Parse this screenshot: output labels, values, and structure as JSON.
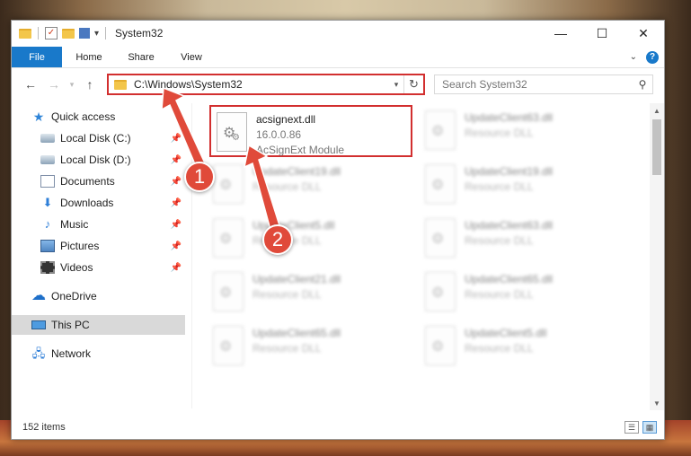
{
  "window": {
    "title": "System32",
    "controls": {
      "minimize": "—",
      "maximize": "☐",
      "close": "✕"
    }
  },
  "ribbon": {
    "tabs": [
      "File",
      "Home",
      "Share",
      "View"
    ],
    "help": "?"
  },
  "address": {
    "path": "C:\\Windows\\System32",
    "search_placeholder": "Search System32"
  },
  "navpane": {
    "quick_access": "Quick access",
    "items": [
      "Local Disk (C:)",
      "Local Disk (D:)",
      "Documents",
      "Downloads",
      "Music",
      "Pictures",
      "Videos"
    ],
    "onedrive": "OneDrive",
    "this_pc": "This PC",
    "network": "Network"
  },
  "files": {
    "highlighted": {
      "name": "acsignext.dll",
      "version": "16.0.0.86",
      "description": "AcSignExt Module"
    },
    "blurred": [
      {
        "name": "UpdateClient63.dll",
        "type": "Resource DLL"
      },
      {
        "name": "UpdateClient19.dll",
        "type": "Resource DLL"
      },
      {
        "name": "UpdateClient19.dll",
        "type": "Resource DLL"
      },
      {
        "name": "UpdateClient5.dll",
        "type": "Resource DLL"
      },
      {
        "name": "UpdateClient63.dll",
        "type": "Resource DLL"
      },
      {
        "name": "UpdateClient21.dll",
        "type": "Resource DLL"
      },
      {
        "name": "UpdateClient65.dll",
        "type": "Resource DLL"
      },
      {
        "name": "UpdateClient65.dll",
        "type": "Resource DLL"
      },
      {
        "name": "UpdateClient5.dll",
        "type": "Resource DLL"
      }
    ]
  },
  "status": {
    "item_count": "152 items"
  },
  "annotations": {
    "badge1": "1",
    "badge2": "2",
    "accent_color": "#e04a3a"
  }
}
